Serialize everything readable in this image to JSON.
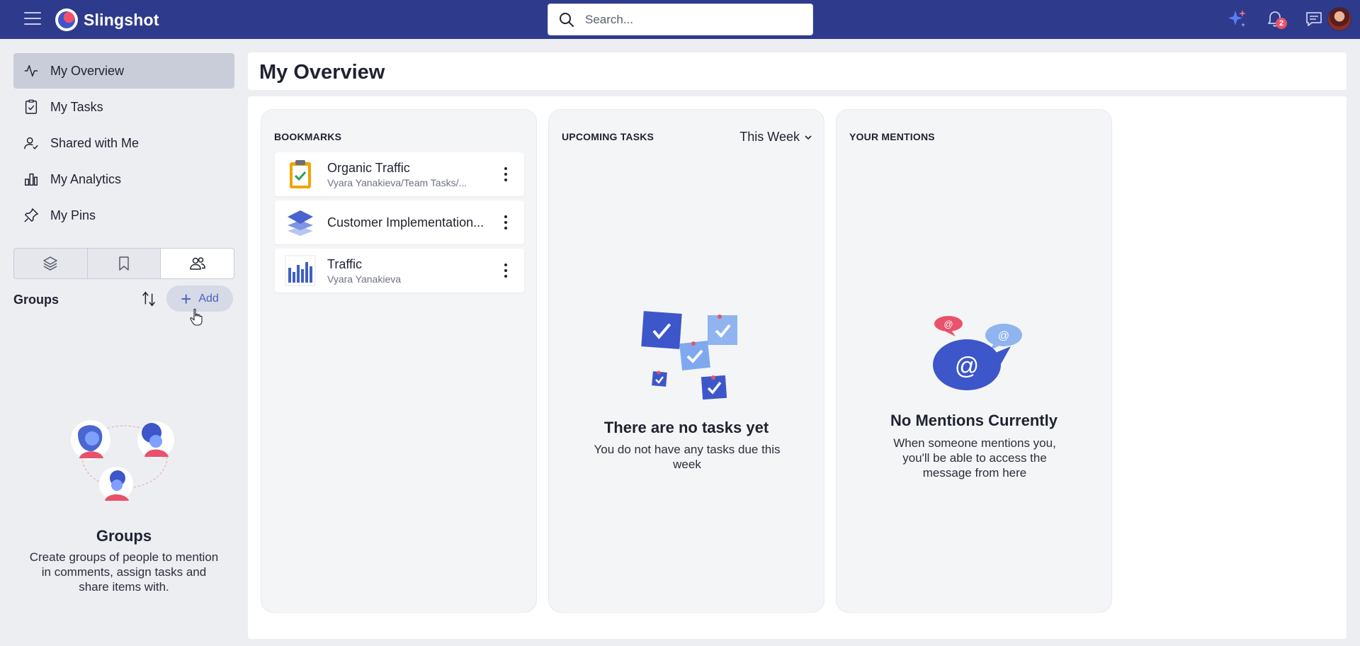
{
  "app": {
    "name": "Slingshot"
  },
  "header": {
    "search_placeholder": "Search...",
    "notification_count": "2"
  },
  "sidebar": {
    "nav": [
      {
        "label": "My Overview",
        "icon": "activity-icon",
        "active": true
      },
      {
        "label": "My Tasks",
        "icon": "task-check-icon",
        "active": false
      },
      {
        "label": "Shared with Me",
        "icon": "user-check-icon",
        "active": false
      },
      {
        "label": "My Analytics",
        "icon": "bar-chart-icon",
        "active": false
      },
      {
        "label": "My Pins",
        "icon": "pin-icon",
        "active": false
      }
    ],
    "segments": [
      {
        "icon": "layers-icon",
        "active": false
      },
      {
        "icon": "bookmark-icon",
        "active": false
      },
      {
        "icon": "users-icon",
        "active": true
      }
    ],
    "groups": {
      "title": "Groups",
      "add_label": "Add",
      "empty_title": "Groups",
      "empty_text": "Create groups of people to mention in comments, assign tasks and share items with."
    }
  },
  "main": {
    "title": "My Overview",
    "bookmarks": {
      "title": "BOOKMARKS",
      "items": [
        {
          "title": "Organic Traffic",
          "subtitle": "Vyara Yanakieva/Team Tasks/...",
          "icon": "clipboard-check-icon"
        },
        {
          "title": "Customer Implementation...",
          "subtitle": "",
          "icon": "layers-stack-icon"
        },
        {
          "title": "Traffic",
          "subtitle": "Vyara Yanakieva",
          "icon": "dashboard-chart-icon"
        }
      ]
    },
    "tasks": {
      "title": "UPCOMING TASKS",
      "filter": "This Week",
      "empty_title": "There are no tasks yet",
      "empty_text": "You do not have any tasks due this week"
    },
    "mentions": {
      "title": "YOUR MENTIONS",
      "empty_title": "No Mentions Currently",
      "empty_text": "When someone mentions you, you'll be able to access the message from here"
    }
  },
  "colors": {
    "topbar": "#2e3a8c",
    "accent": "#4a5fc1",
    "badge": "#e8536b"
  }
}
